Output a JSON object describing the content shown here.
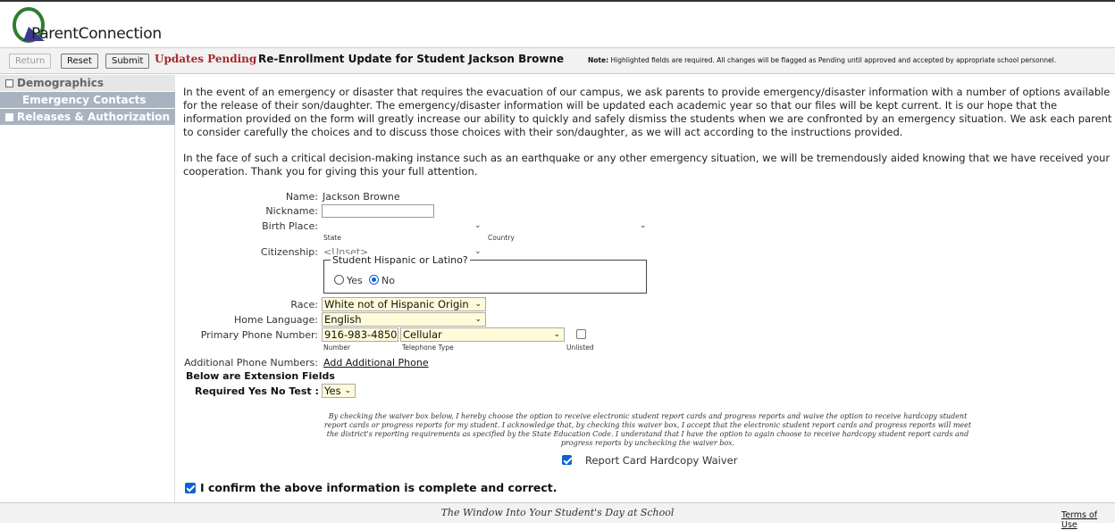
{
  "header": {
    "logo_text": "ParentConnection",
    "brand_color": "#2e7d32"
  },
  "toolbar": {
    "return_label": "Return",
    "reset_label": "Reset",
    "submit_label": "Submit",
    "status": "Updates Pending",
    "title": "Re-Enrollment Update for Student Jackson Browne",
    "note_label": "Note:",
    "note_text": "Highlighted fields are required. All changes will be flagged as Pending until approved and accepted by appropriate school personnel."
  },
  "sidebar": {
    "items": [
      {
        "label": "Demographics"
      },
      {
        "label": "Emergency Contacts"
      },
      {
        "label": "Releases & Authorization"
      }
    ]
  },
  "intro": {
    "paragraph1": "In the event of an emergency or disaster that requires the evacuation of our campus, we ask parents to provide emergency/disaster information with a number of options available for the release of their son/daughter. The emergency/disaster information will be updated each academic year so that our files will be kept current. It is our hope that the information provided on the form will greatly increase our ability to quickly and safely dismiss the students when we are confronted by an emergency situation. We ask each parent to consider carefully the choices and to discuss those choices with their son/daughter, as we will act according to the instructions provided.",
    "paragraph2": "In the face of such a critical decision-making instance such as an earthquake or any other emergency situation, we will be tremendously aided knowing that we have received your cooperation. Thank you for giving this your full attention."
  },
  "form": {
    "name_label": "Name:",
    "name_value": "Jackson Browne",
    "nickname_label": "Nickname:",
    "nickname_value": "",
    "birthplace_label": "Birth Place:",
    "state_caption": "State",
    "country_caption": "Country",
    "citizenship_label": "Citizenship:",
    "citizenship_value": "<Unset>",
    "hispanic_legend": "Student Hispanic or Latino?",
    "hispanic_yes": "Yes",
    "hispanic_no": "No",
    "hispanic_selected": "No",
    "race_label": "Race:",
    "race_value": "White not of Hispanic Origin",
    "home_language_label": "Home Language:",
    "home_language_value": "English",
    "phone_label": "Primary Phone Number:",
    "phone_value": "916-983-4850",
    "phone_type_value": "Cellular",
    "phone_number_caption": "Number",
    "phone_type_caption": "Telephone Type",
    "unlisted_caption": "Unlisted",
    "additional_phone_label": "Additional Phone Numbers:",
    "additional_phone_link": "Add Additional Phone",
    "extension_heading": "Below are Extension Fields",
    "required_test_label": "Required Yes No Test :",
    "required_test_value": "Yes"
  },
  "waiver": {
    "text": "By checking the waiver box below, I hereby choose the option to receive electronic student report cards and progress reports and waive the option to receive hardcopy student report cards or progress reports for my student. I acknowledge that, by checking this waiver box, I accept that the electronic student report cards and progress reports will meet the district's reporting requirements as specified by the State Education Code. I understand that I have the option to again choose to receive hardcopy student report cards and progress reports by unchecking the waiver box.",
    "checkbox_label": "Report Card Hardcopy Waiver"
  },
  "confirm": {
    "label": "I confirm the above information is complete and correct."
  },
  "footer": {
    "tagline": "The Window Into Your Student's Day at School",
    "terms_label": "Terms of Use"
  }
}
